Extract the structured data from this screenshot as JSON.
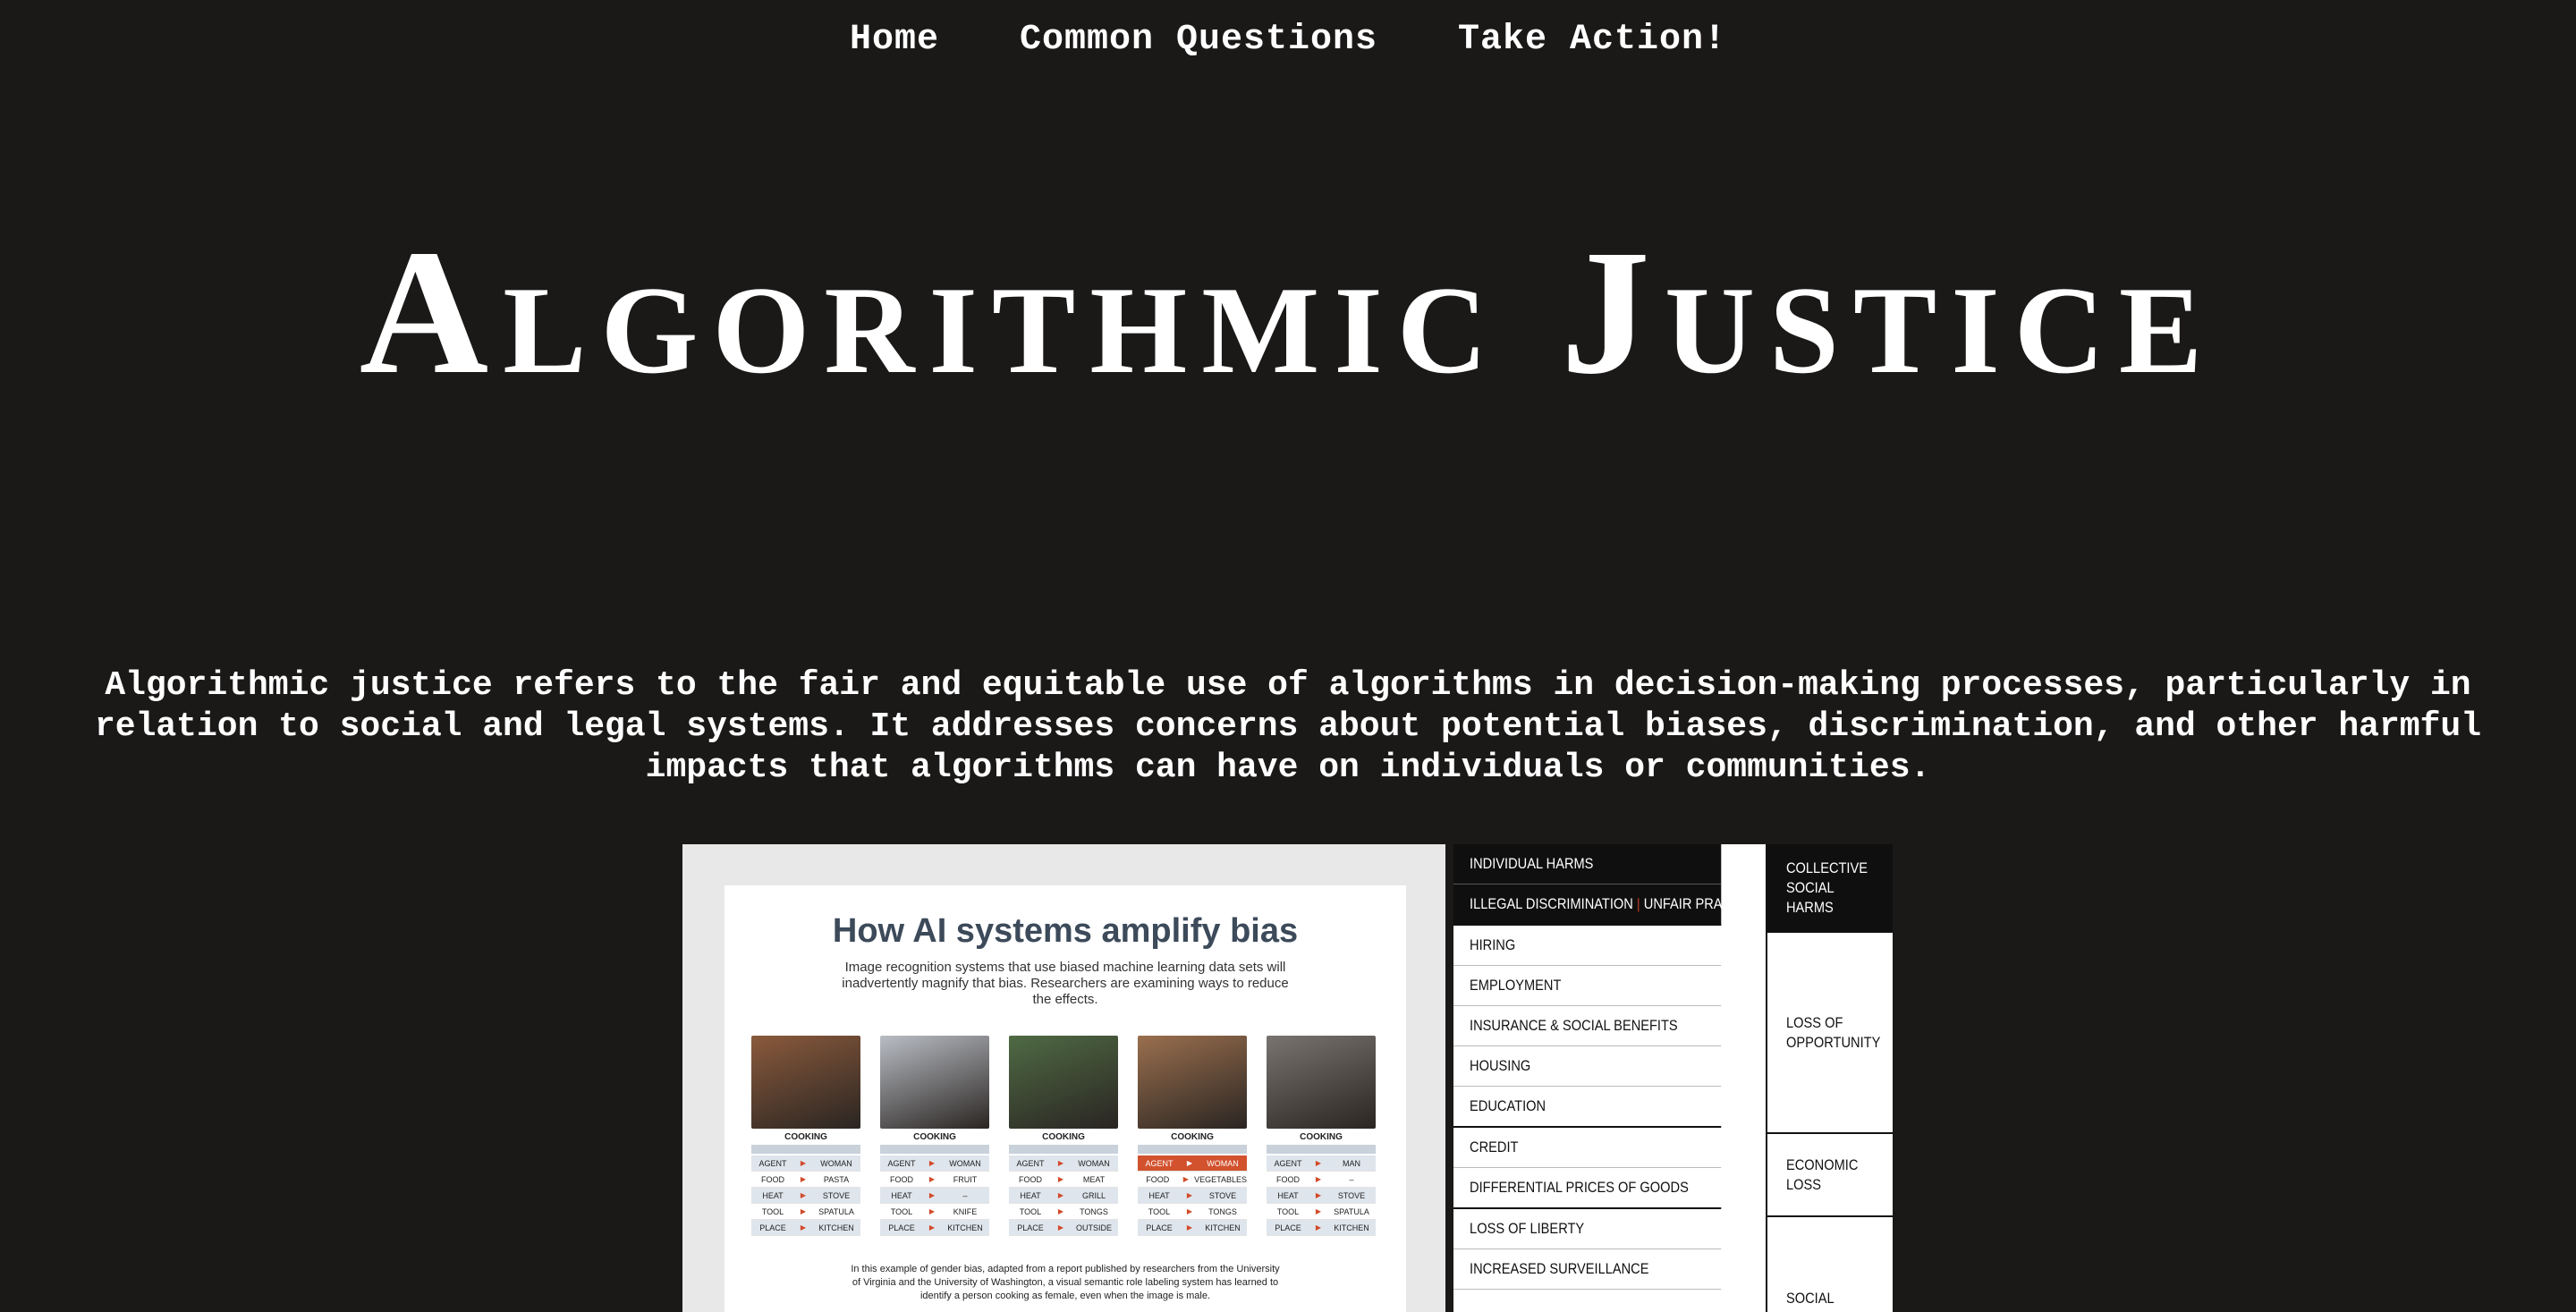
{
  "nav": {
    "items": [
      "Home",
      "Common Questions",
      "Take Action!"
    ]
  },
  "hero": {
    "title": "Algorithmic Justice",
    "intro": "Algorithmic justice refers to the fair and equitable use of algorithms in decision-making processes, particularly in relation to social and legal systems. It addresses concerns about potential biases, discrimination, and other harmful impacts that algorithms can have on individuals or communities."
  },
  "figure_left": {
    "title": "How AI systems amplify bias",
    "subtitle": "Image recognition systems that use biased machine learning data sets will inadvertently magnify that bias. Researchers are examining ways to reduce the effects.",
    "columns": [
      {
        "label": "COOKING",
        "rows": [
          [
            "AGENT",
            "WOMAN"
          ],
          [
            "FOOD",
            "PASTA"
          ],
          [
            "HEAT",
            "STOVE"
          ],
          [
            "TOOL",
            "SPATULA"
          ],
          [
            "PLACE",
            "KITCHEN"
          ]
        ],
        "highlight": false,
        "photo_color": "#8a5a3c"
      },
      {
        "label": "COOKING",
        "rows": [
          [
            "AGENT",
            "WOMAN"
          ],
          [
            "FOOD",
            "FRUIT"
          ],
          [
            "HEAT",
            "–"
          ],
          [
            "TOOL",
            "KNIFE"
          ],
          [
            "PLACE",
            "KITCHEN"
          ]
        ],
        "highlight": false,
        "photo_color": "#b9bdc4"
      },
      {
        "label": "COOKING",
        "rows": [
          [
            "AGENT",
            "WOMAN"
          ],
          [
            "FOOD",
            "MEAT"
          ],
          [
            "HEAT",
            "GRILL"
          ],
          [
            "TOOL",
            "TONGS"
          ],
          [
            "PLACE",
            "OUTSIDE"
          ]
        ],
        "highlight": false,
        "photo_color": "#4f6a44"
      },
      {
        "label": "COOKING",
        "rows": [
          [
            "AGENT",
            "WOMAN"
          ],
          [
            "FOOD",
            "VEGETABLES"
          ],
          [
            "HEAT",
            "STOVE"
          ],
          [
            "TOOL",
            "TONGS"
          ],
          [
            "PLACE",
            "KITCHEN"
          ]
        ],
        "highlight": true,
        "photo_color": "#9a6f4e"
      },
      {
        "label": "COOKING",
        "rows": [
          [
            "AGENT",
            "MAN"
          ],
          [
            "FOOD",
            "–"
          ],
          [
            "HEAT",
            "STOVE"
          ],
          [
            "TOOL",
            "SPATULA"
          ],
          [
            "PLACE",
            "KITCHEN"
          ]
        ],
        "highlight": false,
        "photo_color": "#7a7470"
      }
    ],
    "caption": "In this example of gender bias, adapted from a report published by researchers from the University of Virginia and the University of Washington, a visual semantic role labeling system has learned to identify a person cooking as female, even when the image is male."
  },
  "figure_right": {
    "header_left_1": "INDIVIDUAL HARMS",
    "header_left_2a": "ILLEGAL DISCRIMINATION",
    "header_left_2b": "UNFAIR PRACTICES",
    "header_right": "COLLECTIVE SOCIAL HARMS",
    "rows": [
      "HIRING",
      "EMPLOYMENT",
      "INSURANCE & SOCIAL BENEFITS",
      "HOUSING",
      "EDUCATION",
      "CREDIT",
      "DIFFERENTIAL PRICES OF GOODS",
      "LOSS OF LIBERTY",
      "INCREASED SURVEILLANCE"
    ],
    "groups": [
      "LOSS OF OPPORTUNITY",
      "ECONOMIC LOSS",
      "SOCIAL"
    ]
  }
}
